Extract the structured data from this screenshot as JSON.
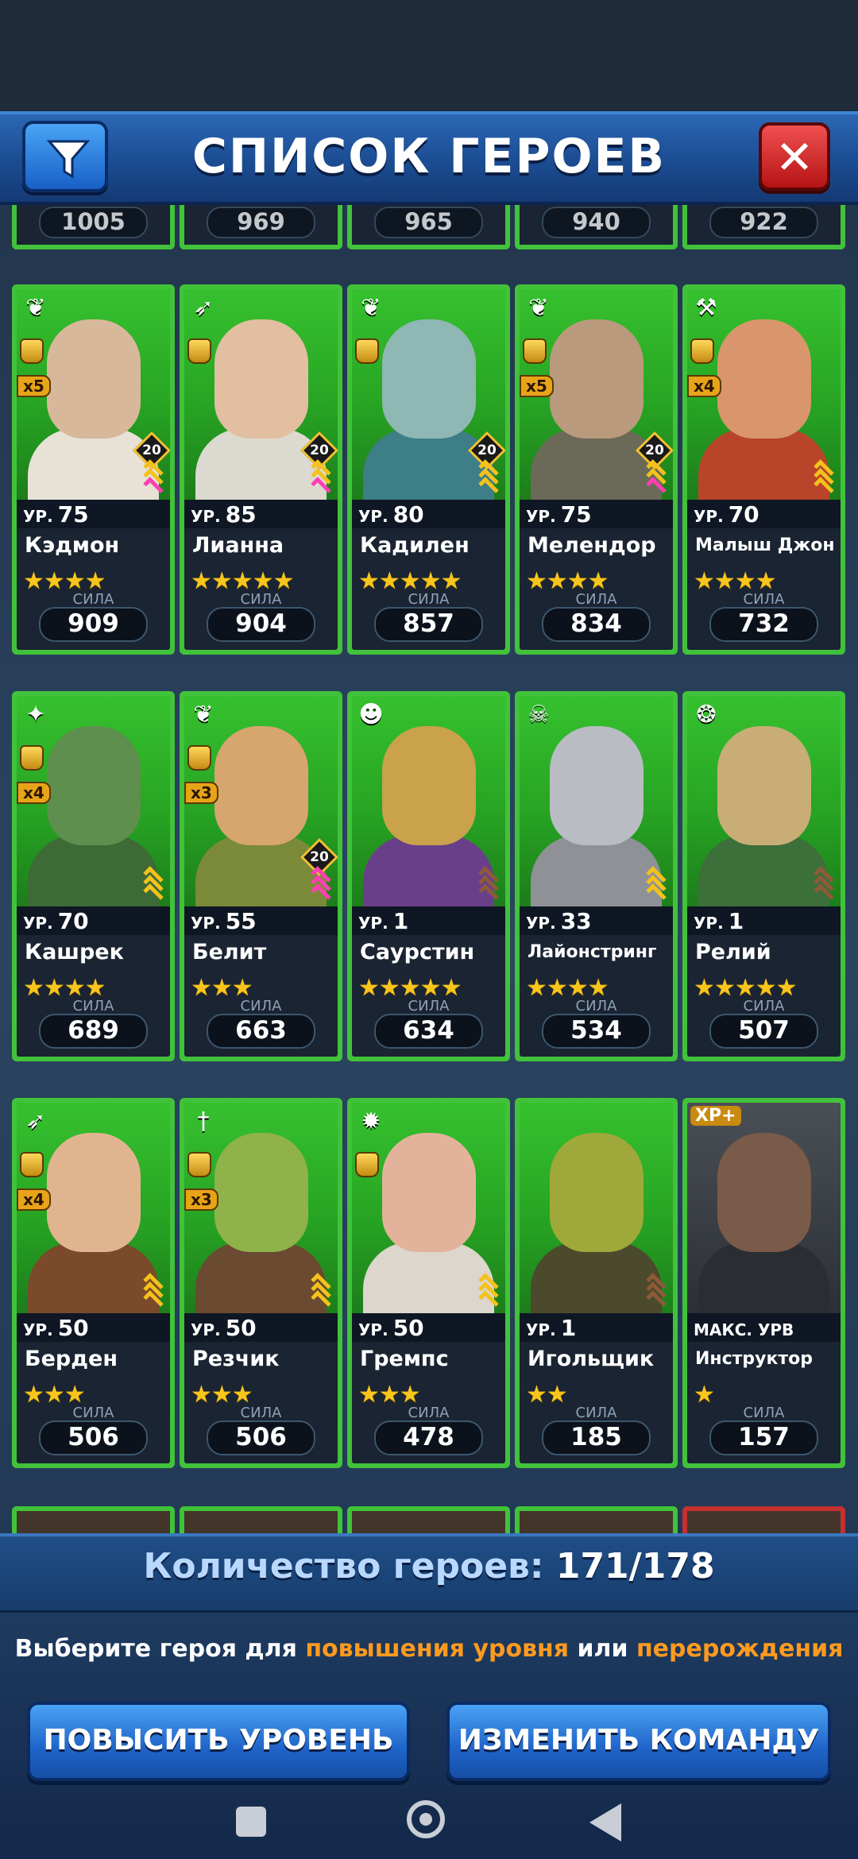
{
  "header": {
    "title": "СПИСОК ГЕРОЕВ",
    "close_symbol": "✕"
  },
  "top_row_powers": [
    "1005",
    "969",
    "965",
    "940",
    "922"
  ],
  "level_prefix": "УР.",
  "power_label": "СИЛА",
  "heroes": [
    {
      "name": "Кэдмон",
      "level_value": "75",
      "stars": "★★★★",
      "power": "909",
      "class_icon": "leaf-icon",
      "class_glyph": "❦",
      "multiplier": "x5",
      "gem": "20",
      "chevrons": [
        "y",
        "y",
        "p"
      ],
      "colors": {
        "face": "#d8b89a",
        "body": "#e8e2d6"
      }
    },
    {
      "name": "Лианна",
      "level_value": "85",
      "stars": "★★★★★",
      "power": "904",
      "class_icon": "bow-icon",
      "class_glyph": "➶",
      "multiplier": "",
      "gem": "20",
      "chevrons": [
        "y",
        "y",
        "p"
      ],
      "colors": {
        "face": "#e2bfa0",
        "body": "#dcdad0"
      }
    },
    {
      "name": "Кадилен",
      "level_value": "80",
      "stars": "★★★★★",
      "power": "857",
      "class_icon": "leaf-icon",
      "class_glyph": "❦",
      "multiplier": "",
      "gem": "20",
      "chevrons": [
        "y",
        "y",
        "y"
      ],
      "colors": {
        "face": "#8fb7b3",
        "body": "#3e7e86"
      }
    },
    {
      "name": "Мелендор",
      "level_value": "75",
      "stars": "★★★★",
      "power": "834",
      "class_icon": "leaf-icon",
      "class_glyph": "❦",
      "multiplier": "x5",
      "gem": "20",
      "chevrons": [
        "y",
        "y",
        "p"
      ],
      "colors": {
        "face": "#b99a7c",
        "body": "#6b6a58"
      }
    },
    {
      "name": "Малыш Джон",
      "level_value": "70",
      "stars": "★★★★",
      "power": "732",
      "class_icon": "axe-icon",
      "class_glyph": "⚒",
      "multiplier": "x4",
      "gem": "",
      "chevrons": [
        "y",
        "y",
        "y"
      ],
      "colors": {
        "face": "#d9966c",
        "body": "#b8452a"
      }
    },
    {
      "name": "Кашрек",
      "level_value": "70",
      "stars": "★★★★",
      "power": "689",
      "class_icon": "spellbook-icon",
      "class_glyph": "✦",
      "multiplier": "x4",
      "gem": "",
      "chevrons": [
        "y",
        "y",
        "y"
      ],
      "colors": {
        "face": "#5e8f4e",
        "body": "#3d6a35"
      }
    },
    {
      "name": "Белит",
      "level_value": "55",
      "stars": "★★★",
      "power": "663",
      "class_icon": "leaf-icon",
      "class_glyph": "❦",
      "multiplier": "x3",
      "gem": "20",
      "chevrons": [
        "p",
        "p",
        "p"
      ],
      "colors": {
        "face": "#d7a56e",
        "body": "#7a8a38"
      }
    },
    {
      "name": "Саурстин",
      "level_value": "1",
      "stars": "★★★★★",
      "power": "634",
      "class_icon": "goblin-icon",
      "class_glyph": "☻",
      "multiplier": "",
      "gem": "",
      "chevrons": [
        "b",
        "b",
        "b"
      ],
      "colors": {
        "face": "#c9a24b",
        "body": "#6a3f8a"
      }
    },
    {
      "name": "Лайонстринг",
      "level_value": "33",
      "stars": "★★★★",
      "power": "534",
      "class_icon": "skull-icon",
      "class_glyph": "☠",
      "multiplier": "",
      "gem": "",
      "chevrons": [
        "y",
        "y",
        "y"
      ],
      "colors": {
        "face": "#b9bcc2",
        "body": "#8e9297"
      }
    },
    {
      "name": "Релий",
      "level_value": "1",
      "stars": "★★★★★",
      "power": "507",
      "class_icon": "owl-icon",
      "class_glyph": "❂",
      "multiplier": "",
      "gem": "",
      "chevrons": [
        "b",
        "b",
        "b"
      ],
      "colors": {
        "face": "#c9ad77",
        "body": "#3d6f3a"
      }
    },
    {
      "name": "Берден",
      "level_value": "50",
      "stars": "★★★",
      "power": "506",
      "class_icon": "bow-icon",
      "class_glyph": "➶",
      "multiplier": "x4",
      "gem": "",
      "chevrons": [
        "y",
        "y",
        "y"
      ],
      "colors": {
        "face": "#e0b48e",
        "body": "#7a4a2a"
      }
    },
    {
      "name": "Резчик",
      "level_value": "50",
      "stars": "★★★",
      "power": "506",
      "class_icon": "dagger-icon",
      "class_glyph": "†",
      "multiplier": "x3",
      "gem": "",
      "chevrons": [
        "y",
        "y",
        "y"
      ],
      "colors": {
        "face": "#8fb24a",
        "body": "#6a4a30"
      }
    },
    {
      "name": "Гремпс",
      "level_value": "50",
      "stars": "★★★",
      "power": "478",
      "class_icon": "sun-icon",
      "class_glyph": "✹",
      "multiplier": "",
      "gem": "",
      "chevrons": [
        "y",
        "y",
        "y"
      ],
      "colors": {
        "face": "#e2b39a",
        "body": "#dcd6cc"
      }
    },
    {
      "name": "Игольщик",
      "level_value": "1",
      "stars": "★★",
      "power": "185",
      "class_icon": "",
      "class_glyph": "",
      "multiplier": "",
      "gem": "",
      "chevrons": [
        "b",
        "b",
        "b"
      ],
      "colors": {
        "face": "#9fa93a",
        "body": "#4c4a2c"
      }
    },
    {
      "name": "Инструктор",
      "level_value": "",
      "level_text": "МАКС. УРВ",
      "stars": "★",
      "power": "157",
      "class_icon": "xp-tag-icon",
      "xp_tag": "XP+",
      "multiplier": "",
      "gem": "",
      "chevrons": [],
      "gray": true,
      "colors": {
        "face": "#7a5a48",
        "body": "#2a2e33"
      }
    }
  ],
  "footer": {
    "count_label": "Количество героев:",
    "count_value": "171/178",
    "hint_part1": "Выберите героя для ",
    "hint_highlight1": "повышения уровня",
    "hint_part2": " или ",
    "hint_highlight2": "перерождения",
    "level_up_button": "ПОВЫСИТЬ УРОВЕНЬ",
    "change_team_button": "ИЗМЕНИТЬ КОМАНДУ"
  },
  "colors": {
    "card_border": "#41c23a",
    "accent_orange": "#ff9a1f",
    "header_blue": "#1b4c92",
    "close_red": "#c81e1e"
  }
}
